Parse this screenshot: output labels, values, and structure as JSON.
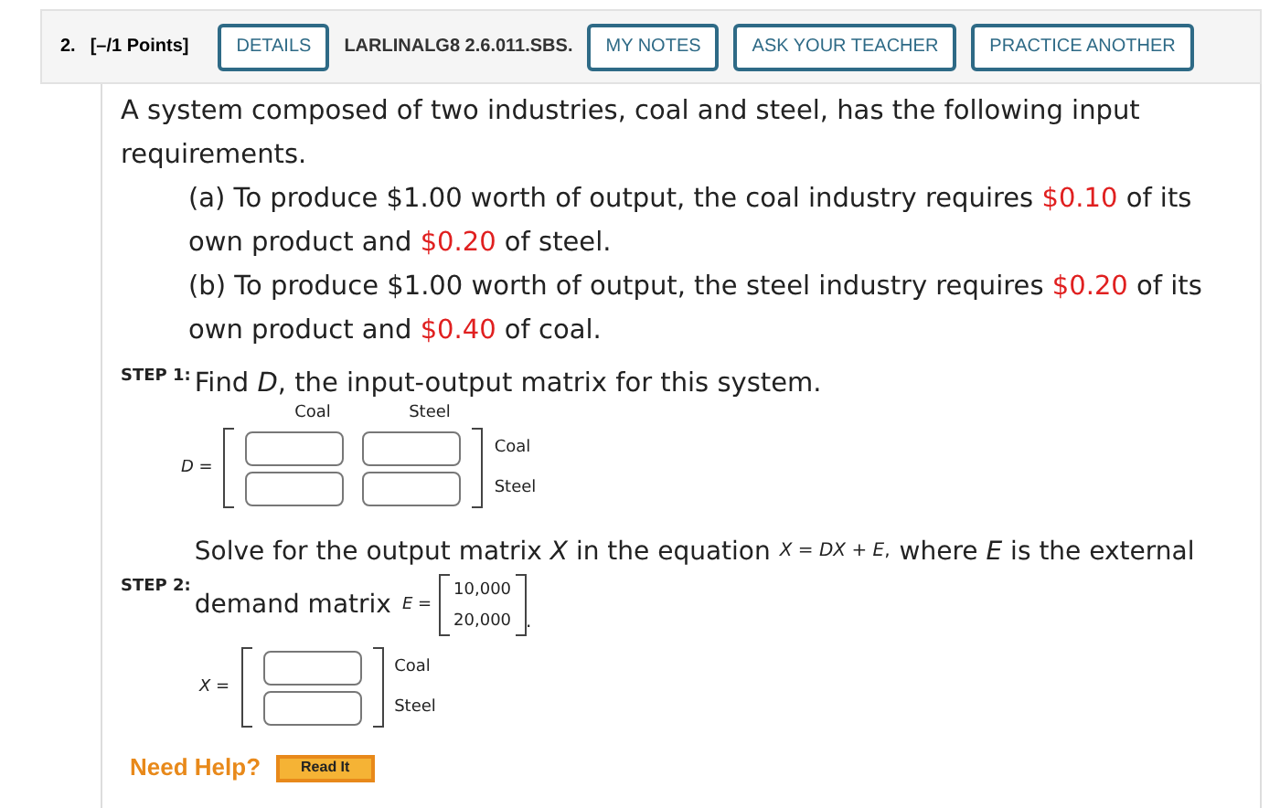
{
  "header": {
    "number": "2.",
    "points": "[–/1 Points]",
    "items": [
      {
        "kind": "button",
        "label": "DETAILS"
      },
      {
        "kind": "label",
        "label": "LARLINALG8 2.6.011.SBS."
      },
      {
        "kind": "button",
        "label": "MY NOTES"
      },
      {
        "kind": "button",
        "label": "ASK YOUR TEACHER"
      },
      {
        "kind": "button",
        "label": "PRACTICE ANOTHER"
      }
    ]
  },
  "intro": "A system composed of two industries, coal and steel, has the following input requirements.",
  "parts": [
    [
      {
        "text": "(a) To produce $1.00 worth of output, the coal industry requires ",
        "highlighted": false
      },
      {
        "text": "$0.10",
        "highlighted": true
      },
      {
        "text": " of its own product and ",
        "highlighted": false
      },
      {
        "text": "$0.20",
        "highlighted": true
      },
      {
        "text": " of steel.",
        "highlighted": false
      }
    ],
    [
      {
        "text": "(b) To produce $1.00 worth of output, the steel industry requires ",
        "highlighted": false
      },
      {
        "text": "$0.20",
        "highlighted": true
      },
      {
        "text": " of its own product and ",
        "highlighted": false
      },
      {
        "text": "$0.40",
        "highlighted": true
      },
      {
        "text": " of coal.",
        "highlighted": false
      }
    ]
  ],
  "step1": {
    "label": "STEP 1:",
    "text": "Find *D*, the input-output matrix for this system.",
    "matrix": {
      "name": "*D* =",
      "columns": [
        "Coal",
        "Steel"
      ],
      "rows": [
        "Coal",
        "Steel"
      ]
    }
  },
  "step2": {
    "label": "STEP 2:",
    "text_before": "Solve for the output matrix *X* in the equation",
    "equation": "*X* = *DX* + *E*,",
    "text_after": "where *E* is the external",
    "text_line2": "demand matrix",
    "e_name": "*E* =",
    "e_values": [
      "10,000",
      "20,000"
    ],
    "e_end": ".",
    "matrix": {
      "name": "*X* =",
      "rows": [
        "Coal",
        "Steel"
      ]
    }
  },
  "help": {
    "label": "Need Help?",
    "button": "Read It"
  }
}
